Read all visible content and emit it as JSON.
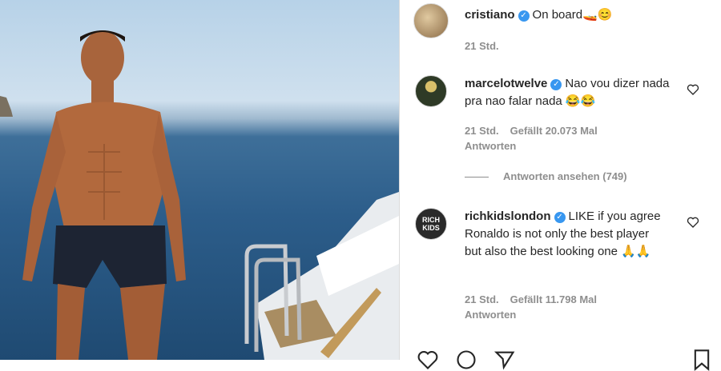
{
  "post": {
    "author": "cristiano",
    "caption": "On board🚤😊",
    "time": "21 Std."
  },
  "comments": [
    {
      "user": "marcelotwelve",
      "text": "Nao vou dizer nada pra nao falar nada 😂😂",
      "time": "21 Std.",
      "likes": "Gefällt 20.073 Mal",
      "reply": "Antworten",
      "view_replies": "Antworten ansehen (749)"
    },
    {
      "user": "richkidslondon",
      "text": "LIKE if you agree Ronaldo is not only the best player but also the best looking one 🙏🙏",
      "time": "21 Std.",
      "likes": "Gefällt 11.798 Mal",
      "reply": "Antworten",
      "avatar_text": "RICH KIDS"
    }
  ],
  "icons": {
    "verified": "verified-check-icon",
    "like": "heart-outline-icon",
    "comment": "comment-bubble-icon",
    "share": "paper-plane-icon",
    "save": "bookmark-icon"
  },
  "colors": {
    "verified": "#3897f0",
    "meta_text": "#8e8e8e",
    "text": "#262626"
  }
}
